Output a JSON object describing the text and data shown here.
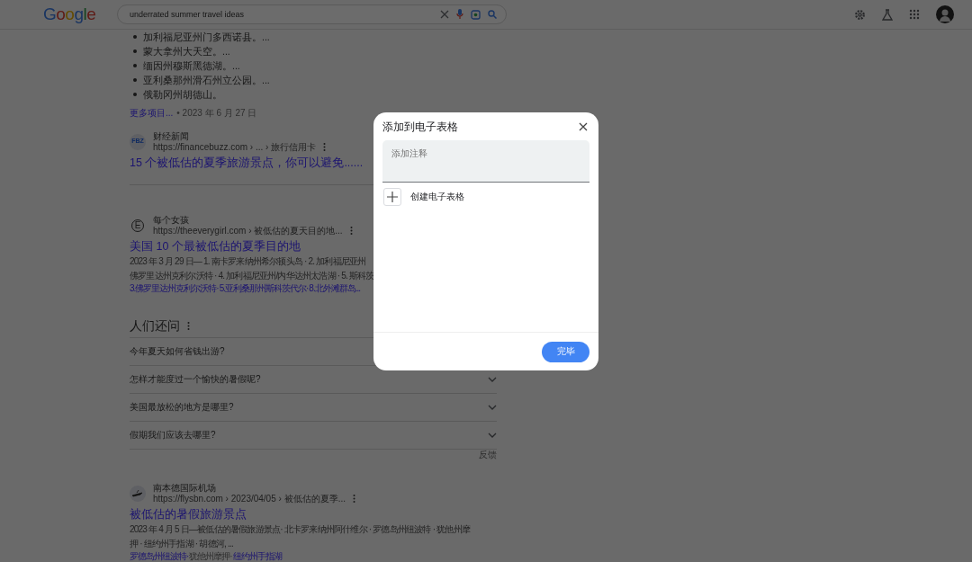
{
  "header": {
    "logo": "Google",
    "search": {
      "value": "underrated summer travel ideas"
    }
  },
  "list_block": {
    "bullets": [
      "加利福尼亚州门多西诺县。...",
      "蒙大拿州大天空。...",
      "缅因州穆斯黑德湖。...",
      "亚利桑那州滑石州立公园。...",
      "俄勒冈州胡德山。"
    ],
    "more_link": "更多项目...",
    "date": "• 2023 年 6 月 27 日"
  },
  "results": [
    {
      "favicon": "FBZ",
      "site": "财经新闻",
      "url": "https://financebuzz.com › ... › 旅行信用卡",
      "title": "15 个被低估的夏季旅游景点，你可以避免......",
      "divider_after": true
    },
    {
      "favicon": "E",
      "site": "每个女孩",
      "url": "https://theeverygirl.com › 被低估的夏天目的地...",
      "title": "美国 10 个最被低估的夏季目的地",
      "snippet_lines": [
        "2023 年 3 月 29 日— 1. 南卡罗来纳州希尔顿头岛 · 2. 加利福尼亚州",
        "佛罗里达州克利尔沃特 · 4. 加利福尼亚州/内华达州太浩湖 · 5. 斯科茨"
      ],
      "links": [
        {
          "text": "3.佛罗里达州克利尔沃特·",
          "highlighted": true
        },
        {
          "text": "5.亚利桑那州斯科茨代尔·",
          "highlighted": true
        },
        {
          "text": "8.北外滩群岛...",
          "highlighted": true
        }
      ],
      "divider_after": false
    }
  ],
  "people_also_ask": {
    "heading": "人们还问",
    "questions": [
      "今年夏天如何省钱出游?",
      "怎样才能度过一个愉快的暑假呢?",
      "美国最放松的地方是哪里?",
      "假期我们应该去哪里?"
    ],
    "feedback": "反馈"
  },
  "results_after": [
    {
      "site": "南本德国际机场",
      "url": "https://flysbn.com › 2023/04/05 › 被低估的夏季...",
      "title": "被低估的暑假旅游景点",
      "snippet_lines": [
        "2023 年 4 月 5 日—被低估的暑假旅游景点· 北卡罗来纳州阿什维尔 · 罗德岛州纽波特 · 犹他州摩",
        "押 · 纽约州手指湖 · 胡德河, ..."
      ],
      "links": [
        {
          "text": "罗德岛州纽波特·",
          "highlighted": true
        },
        {
          "text": "犹他州摩押·",
          "highlighted": false
        },
        {
          "text": "纽约州手指湖",
          "highlighted": true
        }
      ],
      "divider_after": false
    }
  ],
  "dialog": {
    "title": "添加到电子表格",
    "note": {
      "placeholder": "添加注释"
    },
    "create_label": "创建电子表格",
    "done_button": "完毕"
  }
}
